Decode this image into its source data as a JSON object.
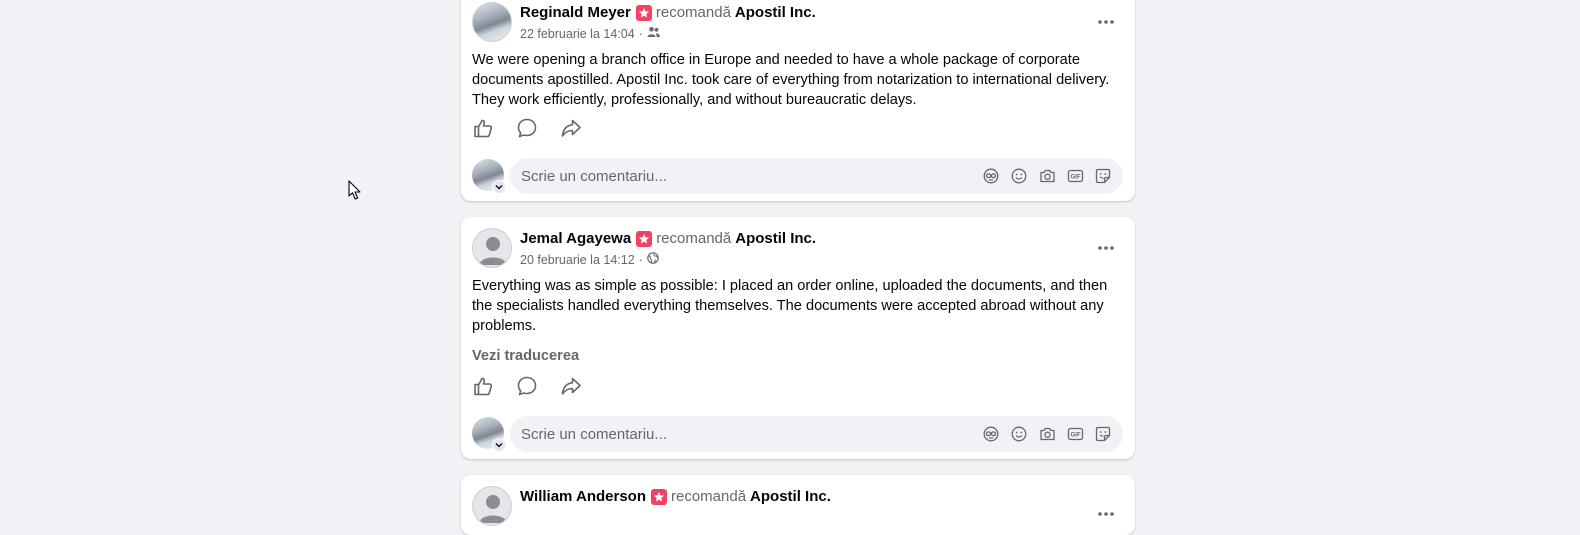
{
  "feed": {
    "posts": [
      {
        "author": "Reginald Meyer",
        "recommends_text": "recomandă",
        "page": "Apostil Inc.",
        "timestamp": "22 februarie la 14:04",
        "audience_icon": "friends-icon",
        "avatar_type": "photo",
        "body": "We were opening a branch office in Europe and needed to have a whole package of corporate documents apostilled. Apostil Inc. took care of everything from notarization to international delivery. They work efficiently, professionally, and without bureaucratic delays.",
        "translate_link": "",
        "comment_placeholder": "Scrie un comentariu..."
      },
      {
        "author": "Jemal Agayewa",
        "recommends_text": "recomandă",
        "page": "Apostil Inc.",
        "timestamp": "20 februarie la 14:12",
        "audience_icon": "globe-icon",
        "avatar_type": "default",
        "body": "Everything was as simple as possible: I placed an order online, uploaded the documents, and then the specialists handled everything themselves. The documents were accepted abroad without any problems.",
        "translate_link": "Vezi traducerea",
        "comment_placeholder": "Scrie un comentariu..."
      },
      {
        "author": "William Anderson",
        "recommends_text": "recomandă",
        "page": "Apostil Inc.",
        "avatar_type": "default"
      }
    ]
  },
  "colors": {
    "background": "#f0f2f5",
    "card": "#ffffff",
    "recommend_badge": "#f3425f",
    "secondary_text": "#65676b"
  }
}
